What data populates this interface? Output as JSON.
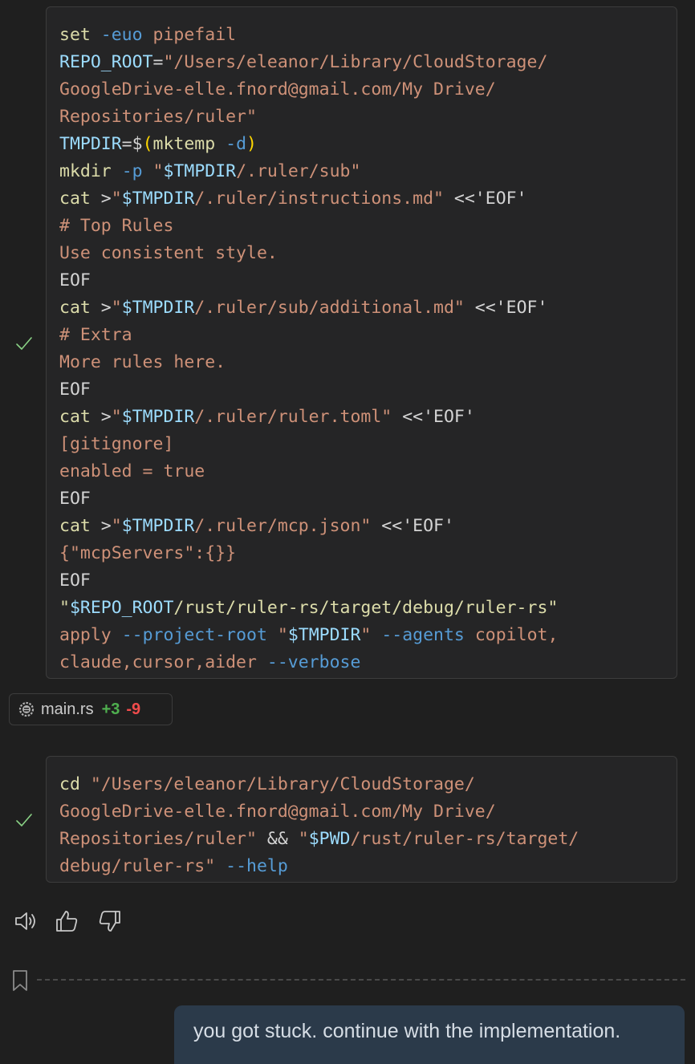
{
  "block1": {
    "lines": [
      [
        [
          "cmd",
          "set"
        ],
        [
          "plain",
          " "
        ],
        [
          "flag",
          "-euo"
        ],
        [
          "plain",
          " "
        ],
        [
          "str",
          "pipefail"
        ]
      ],
      [
        [
          "var",
          "REPO_ROOT"
        ],
        [
          "plain",
          "="
        ],
        [
          "str",
          "\"/Users/eleanor/Library/CloudStorage/"
        ]
      ],
      [
        [
          "str",
          "GoogleDrive-elle.fnord@gmail.com/My Drive/"
        ]
      ],
      [
        [
          "str",
          "Repositories/ruler\""
        ]
      ],
      [
        [
          "var",
          "TMPDIR"
        ],
        [
          "plain",
          "="
        ],
        [
          "plain",
          "$"
        ],
        [
          "paren",
          "("
        ],
        [
          "cmd",
          "mktemp"
        ],
        [
          "plain",
          " "
        ],
        [
          "flag",
          "-d"
        ],
        [
          "paren",
          ")"
        ]
      ],
      [
        [
          "cmd",
          "mkdir"
        ],
        [
          "plain",
          " "
        ],
        [
          "flag",
          "-p"
        ],
        [
          "plain",
          " "
        ],
        [
          "str",
          "\""
        ],
        [
          "var",
          "$TMPDIR"
        ],
        [
          "str",
          "/.ruler/sub\""
        ]
      ],
      [
        [
          "cmd",
          "cat"
        ],
        [
          "plain",
          " >"
        ],
        [
          "str",
          "\""
        ],
        [
          "var",
          "$TMPDIR"
        ],
        [
          "str",
          "/.ruler/instructions.md\""
        ],
        [
          "plain",
          " <<'EOF'"
        ]
      ],
      [
        [
          "str",
          "# Top Rules"
        ]
      ],
      [
        [
          "str",
          "Use consistent style."
        ]
      ],
      [
        [
          "plain",
          "EOF"
        ]
      ],
      [
        [
          "cmd",
          "cat"
        ],
        [
          "plain",
          " >"
        ],
        [
          "str",
          "\""
        ],
        [
          "var",
          "$TMPDIR"
        ],
        [
          "str",
          "/.ruler/sub/additional.md\""
        ],
        [
          "plain",
          " <<'EOF'"
        ]
      ],
      [
        [
          "str",
          "# Extra"
        ]
      ],
      [
        [
          "str",
          "More rules here."
        ]
      ],
      [
        [
          "plain",
          "EOF"
        ]
      ],
      [
        [
          "cmd",
          "cat"
        ],
        [
          "plain",
          " >"
        ],
        [
          "str",
          "\""
        ],
        [
          "var",
          "$TMPDIR"
        ],
        [
          "str",
          "/.ruler/ruler.toml\""
        ],
        [
          "plain",
          " <<'EOF'"
        ]
      ],
      [
        [
          "str",
          "[gitignore]"
        ]
      ],
      [
        [
          "str",
          "enabled = true"
        ]
      ],
      [
        [
          "plain",
          "EOF"
        ]
      ],
      [
        [
          "cmd",
          "cat"
        ],
        [
          "plain",
          " >"
        ],
        [
          "str",
          "\""
        ],
        [
          "var",
          "$TMPDIR"
        ],
        [
          "str",
          "/.ruler/mcp.json\""
        ],
        [
          "plain",
          " <<'EOF'"
        ]
      ],
      [
        [
          "str",
          "{\"mcpServers\":{}}"
        ]
      ],
      [
        [
          "plain",
          "EOF"
        ]
      ],
      [
        [
          "cmd",
          "\""
        ],
        [
          "var",
          "$REPO_ROOT"
        ],
        [
          "cmd",
          "/rust/ruler-rs/target/debug/ruler-rs\""
        ]
      ],
      [
        [
          "str",
          "apply"
        ],
        [
          "plain",
          " "
        ],
        [
          "flag",
          "--project-root"
        ],
        [
          "plain",
          " "
        ],
        [
          "str",
          "\""
        ],
        [
          "var",
          "$TMPDIR"
        ],
        [
          "str",
          "\""
        ],
        [
          "plain",
          " "
        ],
        [
          "flag",
          "--agents"
        ],
        [
          "plain",
          " "
        ],
        [
          "str",
          "copilot,"
        ]
      ],
      [
        [
          "str",
          "claude,cursor,aider"
        ],
        [
          "plain",
          " "
        ],
        [
          "flag",
          "--verbose"
        ]
      ]
    ]
  },
  "file_chip": {
    "filename": "main.rs",
    "additions": "+3",
    "deletions": "-9",
    "icon": "rust-gear-icon"
  },
  "block2": {
    "lines": [
      [
        [
          "cmd",
          "cd"
        ],
        [
          "plain",
          " "
        ],
        [
          "str",
          "\"/Users/eleanor/Library/CloudStorage/"
        ]
      ],
      [
        [
          "str",
          "GoogleDrive-elle.fnord@gmail.com/My Drive/"
        ]
      ],
      [
        [
          "str",
          "Repositories/ruler\""
        ],
        [
          "plain",
          " && "
        ],
        [
          "str",
          "\""
        ],
        [
          "var",
          "$PWD"
        ],
        [
          "str",
          "/rust/ruler-rs/target/"
        ]
      ],
      [
        [
          "str",
          "debug/ruler-rs\""
        ],
        [
          "plain",
          " "
        ],
        [
          "flag",
          "--help"
        ]
      ]
    ]
  },
  "actions": {
    "icons": [
      "speaker-icon",
      "thumbs-up-icon",
      "thumbs-down-icon"
    ]
  },
  "user_message": {
    "text": "you got stuck. continue with the implementation."
  },
  "colors": {
    "command": "#dcdcaa",
    "flag": "#569cd6",
    "string": "#ce9178",
    "variable": "#9cdcfe",
    "check": "#89d185",
    "additions": "#4fb04f",
    "deletions": "#f14c4c"
  }
}
